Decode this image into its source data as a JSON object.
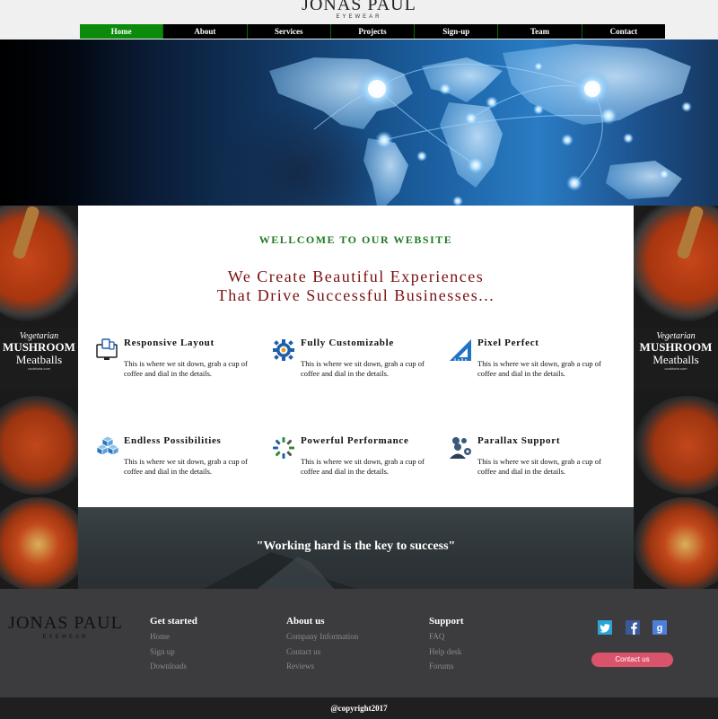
{
  "brand": {
    "name": "JONAS PAUL",
    "tagline": "EYEWEAR"
  },
  "nav": {
    "items": [
      {
        "label": "Home",
        "active": true
      },
      {
        "label": "About"
      },
      {
        "label": "Services"
      },
      {
        "label": "Projects"
      },
      {
        "label": "Sign-up"
      },
      {
        "label": "Team"
      },
      {
        "label": "Contact"
      }
    ]
  },
  "side_banner": {
    "line1": "Vegetarian",
    "line2": "MUSHROOM",
    "line3": "Meatballs",
    "line4": "cooktoria.com"
  },
  "main": {
    "welcome": "WELLCOME TO OUR WEBSITE",
    "headline_line1": "We Create Beautiful Experiences",
    "headline_line2": "That Drive Successful Businesses...",
    "features": [
      {
        "title": "Responsive Layout",
        "desc": "This is where we sit down, grab a cup of coffee and dial in the details.",
        "icon": "responsive-devices-icon"
      },
      {
        "title": "Fully Customizable",
        "desc": "This is where we sit down, grab a cup of coffee and dial in the details.",
        "icon": "gear-icon"
      },
      {
        "title": "Pixel Perfect",
        "desc": "This is where we sit down, grab a cup of coffee and dial in the details.",
        "icon": "ruler-triangle-icon"
      },
      {
        "title": "Endless Possibilities",
        "desc": "This is where we sit down, grab a cup of coffee and dial in the details.",
        "icon": "cubes-icon"
      },
      {
        "title": "Powerful Performance",
        "desc": "This is where we sit down, grab a cup of coffee and dial in the details.",
        "icon": "loading-spinner-icon"
      },
      {
        "title": "Parallax Support",
        "desc": "This is where we sit down, grab a cup of coffee and dial in the details.",
        "icon": "user-gears-icon"
      }
    ]
  },
  "quote": "\"Working hard is the key to success\"",
  "footer": {
    "columns": [
      {
        "heading": "Get started",
        "links": [
          "Home",
          "Sign up",
          "Downloads"
        ]
      },
      {
        "heading": "About us",
        "links": [
          "Company Information",
          "Contact us",
          "Reviews"
        ]
      },
      {
        "heading": "Support",
        "links": [
          "FAQ",
          "Help desk",
          "Forums"
        ]
      }
    ],
    "social": [
      "twitter-icon",
      "facebook-icon",
      "google-plus-icon"
    ],
    "contact_button": "Contact us",
    "copyright": "@copyright2017"
  },
  "colors": {
    "nav_active": "#0b8a0b",
    "welcome": "#1f7a1f",
    "headline": "#7a1010",
    "contact_button": "#d9546b",
    "icon_blue": "#1e5fa8"
  }
}
